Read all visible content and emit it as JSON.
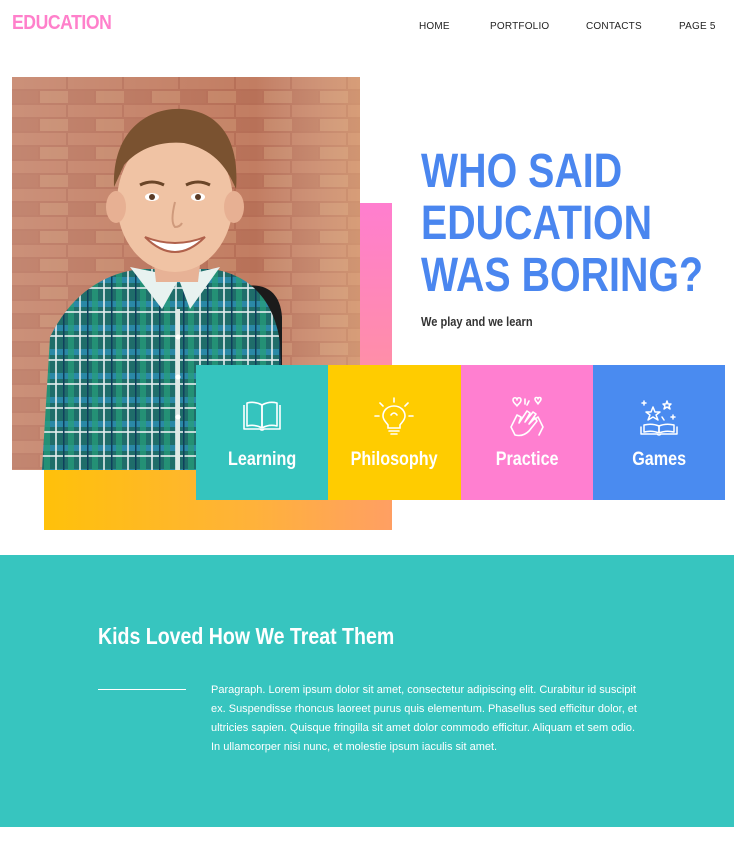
{
  "brand": {
    "logo": "EDUCATION"
  },
  "nav": {
    "items": [
      {
        "label": "HOME"
      },
      {
        "label": "PORTFOLIO"
      },
      {
        "label": "CONTACTS"
      },
      {
        "label": "PAGE 5"
      }
    ]
  },
  "hero": {
    "headline": [
      "WHO SAID",
      "EDUCATION",
      "WAS BORING?"
    ],
    "tagline": "We play and we learn",
    "photo_alt": "smiling boy in plaid shirt with backpack",
    "cards": [
      {
        "label": "Learning",
        "color": "#35c4be",
        "icon": "open-book-icon"
      },
      {
        "label": "Philosophy",
        "color": "#ffcc00",
        "icon": "lightbulb-icon"
      },
      {
        "label": "Practice",
        "color": "#ff7fd0",
        "icon": "clapping-hands-icon"
      },
      {
        "label": "Games",
        "color": "#4a8bf0",
        "icon": "magic-book-icon"
      }
    ]
  },
  "section": {
    "title": "Kids Loved How We Treat Them",
    "paragraph": "Paragraph. Lorem ipsum dolor sit amet, consectetur adipiscing elit. Curabitur id suscipit ex. Suspendisse rhoncus laoreet purus quis elementum. Phasellus sed efficitur dolor, et ultricies sapien. Quisque fringilla sit amet dolor commodo efficitur. Aliquam et sem odio. In ullamcorper nisi nunc, et molestie ipsum iaculis sit amet."
  },
  "colors": {
    "logo": "#ff80cb",
    "headline": "#4a86ef",
    "teal": "#37c5bf",
    "yellow": "#ffc10a",
    "pink": "#ff7ecf"
  }
}
